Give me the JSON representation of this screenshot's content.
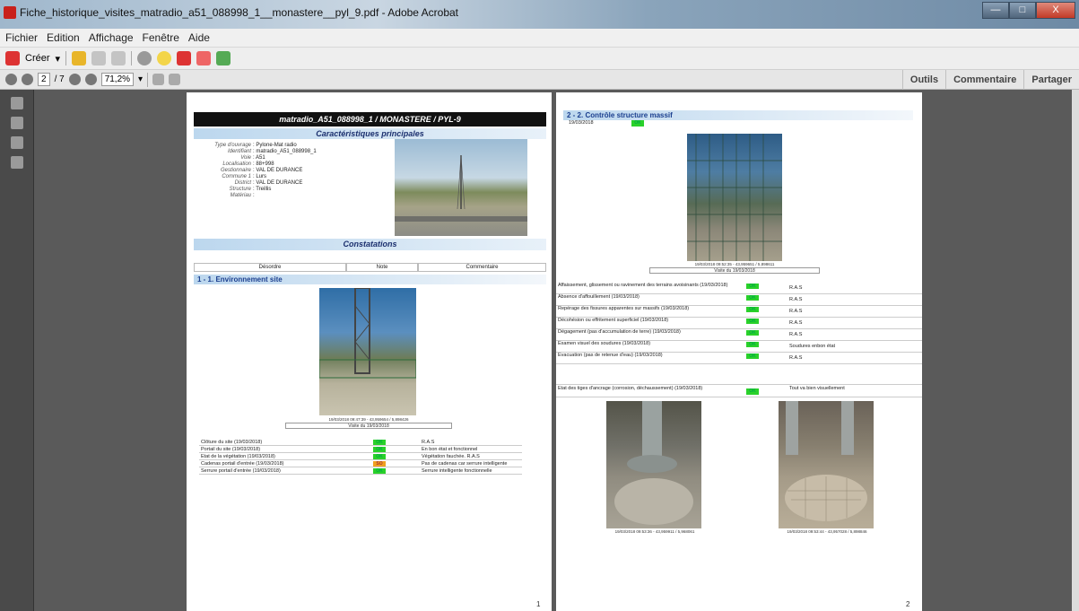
{
  "window": {
    "title": "Fiche_historique_visites_matradio_a51_088998_1__monastere__pyl_9.pdf - Adobe Acrobat",
    "minimize": "—",
    "maximize": "□",
    "close": "X"
  },
  "menu": [
    "Fichier",
    "Edition",
    "Affichage",
    "Fenêtre",
    "Aide"
  ],
  "toolbar": {
    "create_label": "Créer"
  },
  "nav": {
    "page_current": "2",
    "page_total": "/ 7",
    "zoom": "71,2%"
  },
  "right_tools": [
    "Outils",
    "Commentaire",
    "Partager"
  ],
  "page1": {
    "banner": "matradio_A51_088998_1 / MONASTERE / PYL-9",
    "section_main": "Caractéristiques principales",
    "info": [
      {
        "k": "Type d'ouvrage",
        "v": "Pylone-Mat radio"
      },
      {
        "k": "Identifiant",
        "v": "matradio_A51_088998_1"
      },
      {
        "k": "Voie",
        "v": "A51"
      },
      {
        "k": "Localisation",
        "v": "88+998"
      },
      {
        "k": "Gestionnaire",
        "v": "VAL DE DURANCE"
      },
      {
        "k": "Commune 1",
        "v": "Lurs"
      },
      {
        "k": "District",
        "v": "VAL DE DURANCE"
      },
      {
        "k": "Structure",
        "v": "Treillis"
      },
      {
        "k": "Matériau",
        "v": ""
      }
    ],
    "section_const": "Constatations",
    "table_headers": [
      "Désordre",
      "Note",
      "Commentaire"
    ],
    "subsection": "1 - 1. Environnement site",
    "photo_caption": "19/03/2018 09:47:39 - 43,959654 / 5,898426",
    "visit_caption": "Visite du 19/03/2018",
    "rows": [
      {
        "label": "Clôture du site (19/03/2018)",
        "note": "OK",
        "status": "ok",
        "comment": "R.A.S"
      },
      {
        "label": "Portail du site (19/03/2018)",
        "note": "OK",
        "status": "ok",
        "comment": "En bon état et fonctionnel"
      },
      {
        "label": "Etat de la végétation (19/03/2018)",
        "note": "OK",
        "status": "ok",
        "comment": "Végétation fauchée. R.A.S"
      },
      {
        "label": "Cadenas portail d'entrée (19/03/2018)",
        "note": "SO",
        "status": "so",
        "comment": "Pas de cadenas car serrure intelligente"
      },
      {
        "label": "Serrure portail d'entrée (19/03/2018)",
        "note": "OK",
        "status": "ok",
        "comment": "Serrure intelligente fonctionnelle"
      }
    ],
    "page_number": "1"
  },
  "page2": {
    "subsection": "2 - 2. Contrôle structure massif",
    "date": "19/03/2018",
    "date_note": "OK",
    "photo_caption": "19/03/2018 09:52:35 - 43,959651 / 5,898611",
    "visit_caption": "Visite du 19/03/2018",
    "rows": [
      {
        "label": "Affaissement, glissement ou ravinement des terrains avoisinants (19/03/2018)",
        "note": "OK",
        "status": "ok",
        "comment": "R.A.S"
      },
      {
        "label": "Absence d'affouillement (19/03/2018)",
        "note": "OK",
        "status": "ok",
        "comment": "R.A.S"
      },
      {
        "label": "Repérage des fissures apparentes sur massifs (19/03/2018)",
        "note": "OK",
        "status": "ok",
        "comment": "R.A.S"
      },
      {
        "label": "Décohésion ou effritement superficiel (19/03/2018)",
        "note": "OK",
        "status": "ok",
        "comment": "R.A.S"
      },
      {
        "label": "Dégagement (pas d'accumulation de terre) (19/03/2018)",
        "note": "OK",
        "status": "ok",
        "comment": "R.A.S"
      },
      {
        "label": "Examen visuel des soudures (19/03/2018)",
        "note": "OK",
        "status": "ok",
        "comment": "Soudures enbon état"
      },
      {
        "label": "Evacuation (pas de retenue d'eau) (19/03/2018)",
        "note": "OK",
        "status": "ok",
        "comment": "R.A.S"
      }
    ],
    "tige_row": {
      "label": "Etat des tiges d'ancrage (corrosion, déchaussement) (19/03/2018)",
      "note": "OK",
      "comment": "Tout va bien visuellement"
    },
    "photo_a_caption": "19/03/2018 09:53:36 - 43,959911 / 5,968061",
    "photo_b_caption": "19/03/2018 09:53:44 - 43,957028 / 5,898846",
    "page_number": "2"
  }
}
